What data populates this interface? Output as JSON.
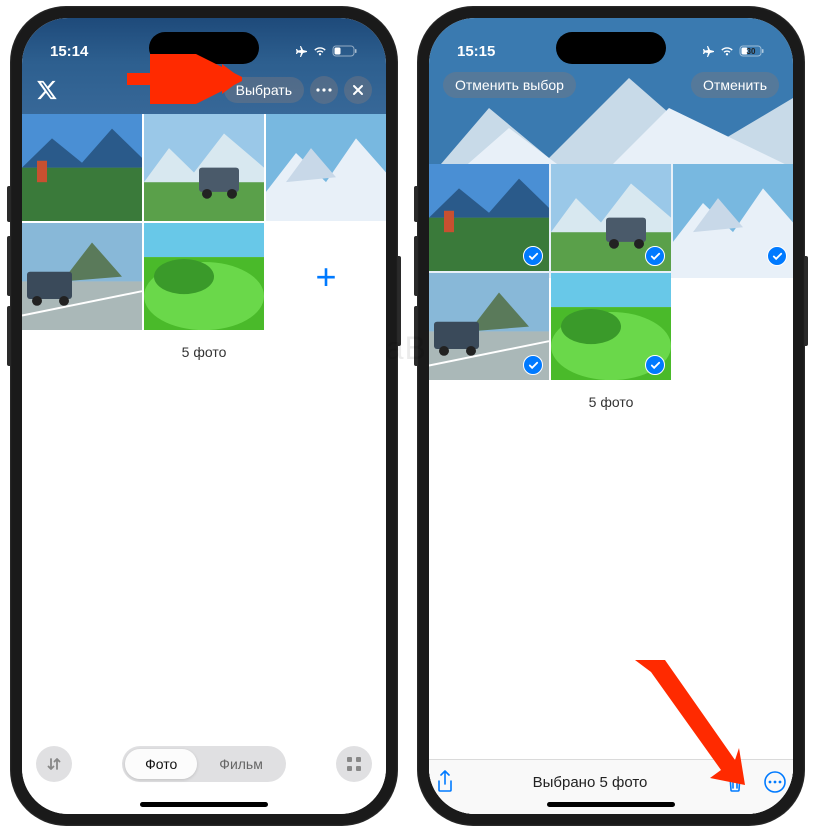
{
  "watermark": "YaBK",
  "phone1": {
    "status": {
      "time": "15:14"
    },
    "header": {
      "back_icon": "x-logo-icon",
      "select_label": "Выбрать",
      "more_icon": "more-icon",
      "close_icon": "close-icon"
    },
    "count_label": "5 фото",
    "add_icon": "+",
    "segmented": {
      "photo": "Фото",
      "film": "Фильм"
    }
  },
  "phone2": {
    "status": {
      "time": "15:15",
      "battery": "30"
    },
    "header": {
      "deselect_label": "Отменить выбор",
      "cancel_label": "Отменить"
    },
    "count_label": "5 фото",
    "toolbar": {
      "selected_label": "Выбрано 5 фото"
    }
  }
}
